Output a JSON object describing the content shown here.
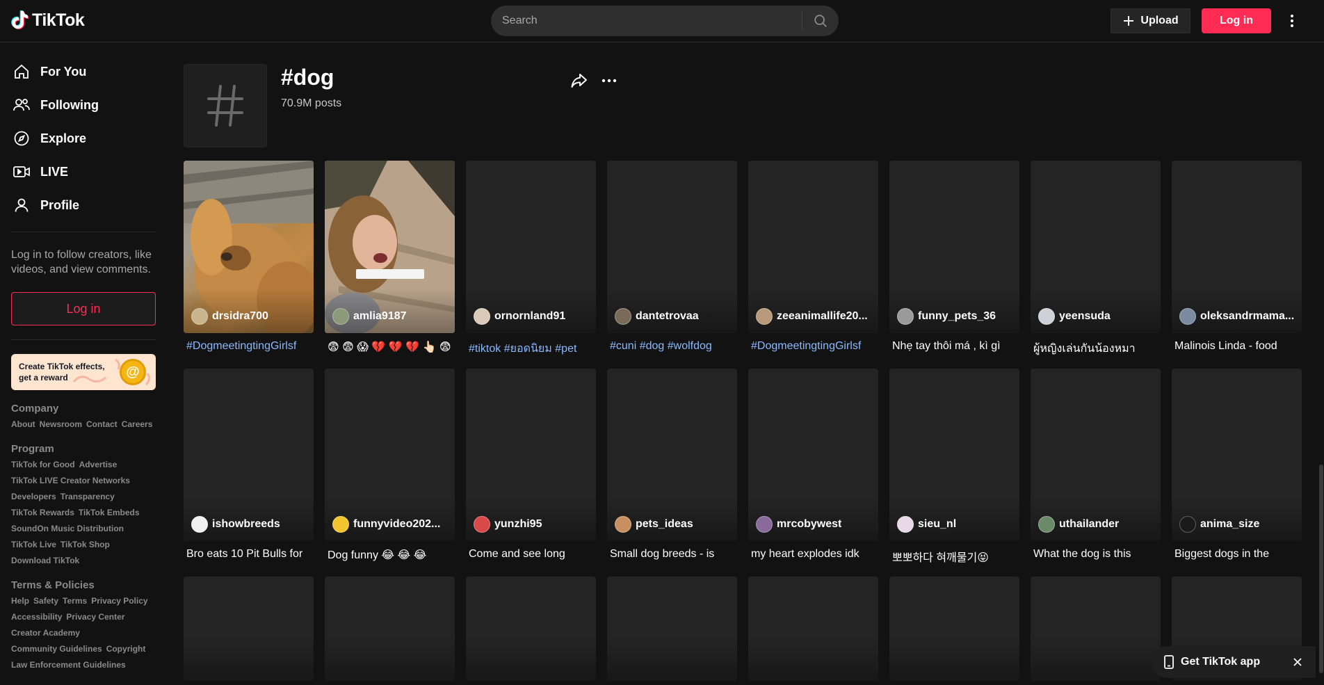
{
  "header": {
    "logo_text": "TikTok",
    "search_placeholder": "Search",
    "upload_label": "Upload",
    "login_label": "Log in"
  },
  "sidebar": {
    "nav": [
      {
        "label": "For You",
        "icon": "home-icon"
      },
      {
        "label": "Following",
        "icon": "following-icon"
      },
      {
        "label": "Explore",
        "icon": "compass-icon"
      },
      {
        "label": "LIVE",
        "icon": "live-icon"
      },
      {
        "label": "Profile",
        "icon": "profile-icon"
      }
    ],
    "login_prompt": "Log in to follow creators, like videos, and view comments.",
    "login_label": "Log in",
    "effects_banner": "Create TikTok effects, get a reward",
    "footer": [
      {
        "title": "Company",
        "links": [
          "About",
          "Newsroom",
          "Contact",
          "Careers"
        ]
      },
      {
        "title": "Program",
        "links": [
          "TikTok for Good",
          "Advertise",
          "TikTok LIVE Creator Networks",
          "Developers",
          "Transparency",
          "TikTok Rewards",
          "TikTok Embeds",
          "SoundOn Music Distribution",
          "TikTok Live",
          "TikTok Shop",
          "Download TikTok"
        ]
      },
      {
        "title": "Terms & Policies",
        "links": [
          "Help",
          "Safety",
          "Terms",
          "Privacy Policy",
          "Accessibility",
          "Privacy Center",
          "Creator Academy",
          "Community Guidelines",
          "Copyright",
          "Law Enforcement Guidelines"
        ]
      }
    ]
  },
  "tag": {
    "title": "#dog",
    "posts": "70.9M posts"
  },
  "videos": [
    {
      "author": "drsidra700",
      "caption": "#DogmeetingtingGirlsf",
      "caption_is_tag": true,
      "avatar_color": "#c9b48d"
    },
    {
      "author": "amlia9187",
      "caption": "😨 😨 😱 💔 💔 💔 👆🏻 😨",
      "caption_is_tag": false,
      "avatar_color": "#8a9a7a"
    },
    {
      "author": "ornornland91",
      "caption": "#tiktok #ยอดนิยม #pet",
      "caption_is_tag": true,
      "avatar_color": "#d8c9b8"
    },
    {
      "author": "dantetrovaa",
      "caption": "#cuni #dog #wolfdog",
      "caption_is_tag": true,
      "avatar_color": "#7a6a5a"
    },
    {
      "author": "zeeanimallife20...",
      "caption": "#DogmeetingtingGirlsf",
      "caption_is_tag": true,
      "avatar_color": "#b89a7a"
    },
    {
      "author": "funny_pets_36",
      "caption": "Nhẹ tay thôi má , kì gì",
      "caption_is_tag": false,
      "avatar_color": "#9a9a9a"
    },
    {
      "author": "yeensuda",
      "caption": "ผู้หญิงเล่นกันน้องหมา",
      "caption_is_tag": false,
      "avatar_color": "#d0d0d8"
    },
    {
      "author": "oleksandrmama...",
      "caption": "Malinois Linda - food",
      "caption_is_tag": false,
      "avatar_color": "#7a8aa0"
    },
    {
      "author": "ishowbreeds",
      "caption": "Bro eats 10 Pit Bulls for",
      "caption_is_tag": false,
      "avatar_color": "#f0f0f0"
    },
    {
      "author": "funnyvideo202...",
      "caption": "Dog funny 😂 😂 😂",
      "caption_is_tag": false,
      "avatar_color": "#f2c52e"
    },
    {
      "author": "yunzhi95",
      "caption": "Come and see long",
      "caption_is_tag": false,
      "avatar_color": "#d84a4a"
    },
    {
      "author": "pets_ideas",
      "caption": "Small dog breeds - is",
      "caption_is_tag": false,
      "avatar_color": "#c89060"
    },
    {
      "author": "mrcobywest",
      "caption": "my heart explodes idk",
      "caption_is_tag": false,
      "avatar_color": "#8a6a9a"
    },
    {
      "author": "sieu_nl",
      "caption": "뽀뽀하다 혀깨물기😝",
      "caption_is_tag": false,
      "avatar_color": "#e8d8e8"
    },
    {
      "author": "uthailander",
      "caption": "What the dog is this",
      "caption_is_tag": false,
      "avatar_color": "#6a8a6a"
    },
    {
      "author": "anima_size",
      "caption": "Biggest dogs in the",
      "caption_is_tag": false,
      "avatar_color": "#1a1a1a"
    }
  ],
  "get_app_label": "Get TikTok app"
}
